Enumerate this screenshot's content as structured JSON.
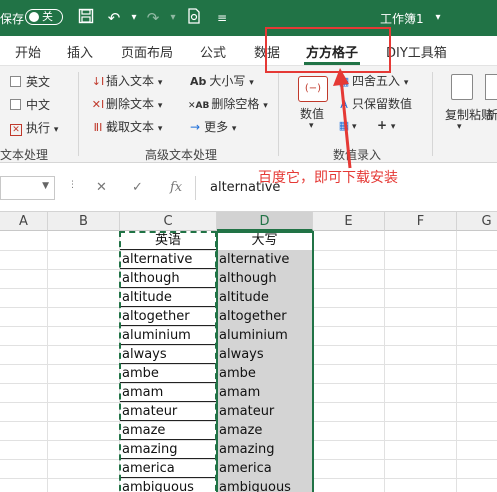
{
  "titlebar": {
    "autosave_label": "保存",
    "autosave_state": "关",
    "doc_title": "工作簿1",
    "bg_color": "#217346"
  },
  "tabs": [
    {
      "label": "开始"
    },
    {
      "label": "插入"
    },
    {
      "label": "页面布局"
    },
    {
      "label": "公式"
    },
    {
      "label": "数据"
    },
    {
      "label": "方方格子",
      "active": true
    },
    {
      "label": "DIY工具箱"
    }
  ],
  "ribbon": {
    "text_group": {
      "items": [
        "英文",
        "中文",
        "执行"
      ],
      "label": "文本处理"
    },
    "advanced_group": {
      "items": [
        "插入文本",
        "删除文本",
        "截取文本",
        "大小写",
        "删除空格",
        "更多"
      ],
      "label": "高级文本处理"
    },
    "number_group": {
      "value_label": "数值",
      "round_label": "四舍五入",
      "keep_value_label": "只保留数值",
      "label": "数值录入"
    },
    "copy_paste_label": "复制粘贴",
    "new_label": "新"
  },
  "annotation": {
    "text": "百度它，即可下载安装",
    "color": "#e53935"
  },
  "formulabar": {
    "fx_label": "fx",
    "value": "alternative"
  },
  "grid": {
    "columns": [
      "A",
      "B",
      "C",
      "D",
      "E",
      "F",
      "G"
    ],
    "selected_column": "D",
    "header_c": "英语",
    "header_d": "大写",
    "words": [
      "alternative",
      "although",
      "altitude",
      "altogether",
      "aluminium",
      "always",
      "ambe",
      "amam",
      "amateur",
      "amaze",
      "amazing",
      "america",
      "ambiguous"
    ],
    "accent_color": "#217346"
  }
}
